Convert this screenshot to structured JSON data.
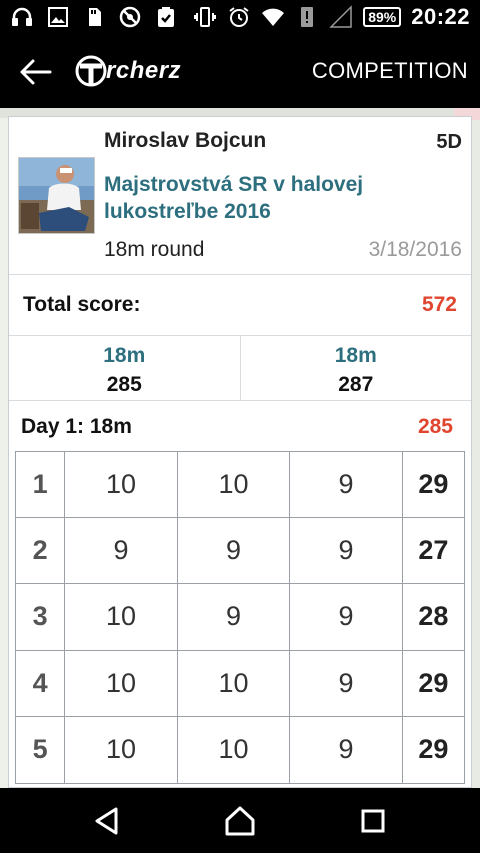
{
  "status_bar": {
    "battery": "89%",
    "time": "20:22",
    "icons_left": [
      "headphones-icon",
      "image-icon",
      "sd-card-icon",
      "no-network-icon",
      "clipboard-check-icon"
    ],
    "icons_right": [
      "vibrate-icon",
      "alarm-icon",
      "wifi-icon",
      "alert-icon",
      "signal-icon",
      "battery-icon"
    ]
  },
  "app_bar": {
    "logo_text": "rcherz",
    "action_label": "COMPETITION"
  },
  "profile": {
    "name": "Miroslav Bojcun",
    "grade": "5D",
    "event": "Majstrovstvá SR v halovej lukostreľbe 2016",
    "round": "18m round",
    "date": "3/18/2016"
  },
  "total": {
    "label": "Total score:",
    "value": "572"
  },
  "rounds": [
    {
      "distance": "18m",
      "score": "285"
    },
    {
      "distance": "18m",
      "score": "287"
    }
  ],
  "day": {
    "label": "Day 1: 18m",
    "value": "285"
  },
  "ends": [
    {
      "n": "1",
      "a": "10",
      "b": "10",
      "c": "9",
      "sum": "29"
    },
    {
      "n": "2",
      "a": "9",
      "b": "9",
      "c": "9",
      "sum": "27"
    },
    {
      "n": "3",
      "a": "10",
      "b": "9",
      "c": "9",
      "sum": "28"
    },
    {
      "n": "4",
      "a": "10",
      "b": "10",
      "c": "9",
      "sum": "29"
    },
    {
      "n": "5",
      "a": "10",
      "b": "10",
      "c": "9",
      "sum": "29"
    }
  ],
  "colors": {
    "accent_teal": "#2d6f7e",
    "score_red": "#e0452f",
    "bar_black": "#000000"
  }
}
